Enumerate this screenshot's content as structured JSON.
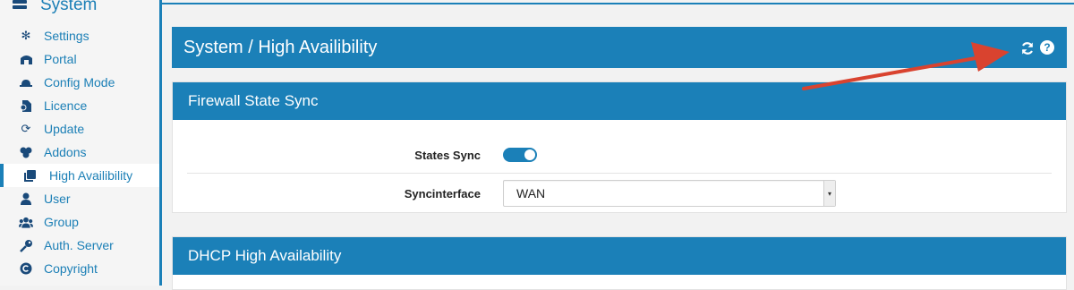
{
  "sidebar": {
    "section_title": "System",
    "items": [
      {
        "label": "Settings",
        "icon": "gear-icon"
      },
      {
        "label": "Portal",
        "icon": "portal-icon"
      },
      {
        "label": "Config Mode",
        "icon": "hat-icon"
      },
      {
        "label": "Licence",
        "icon": "licence-icon"
      },
      {
        "label": "Update",
        "icon": "refresh-icon"
      },
      {
        "label": "Addons",
        "icon": "addons-icon"
      },
      {
        "label": "High Availibility",
        "icon": "copy-icon",
        "active": true
      },
      {
        "label": "User",
        "icon": "user-icon"
      },
      {
        "label": "Group",
        "icon": "group-icon"
      },
      {
        "label": "Auth. Server",
        "icon": "key-icon"
      },
      {
        "label": "Copyright",
        "icon": "copyright-icon"
      }
    ]
  },
  "header": {
    "title": "System / High Availibility",
    "icons": [
      "refresh-icon",
      "help-icon"
    ]
  },
  "firewall_panel": {
    "title": "Firewall State Sync",
    "states_sync_label": "States Sync",
    "states_sync_enabled": true,
    "syncinterface_label": "Syncinterface",
    "syncinterface_value": "WAN"
  },
  "dhcp_panel": {
    "title": "DHCP High Availability"
  },
  "colors": {
    "accent": "#1b80b8",
    "annotation_arrow": "#d9432f"
  }
}
